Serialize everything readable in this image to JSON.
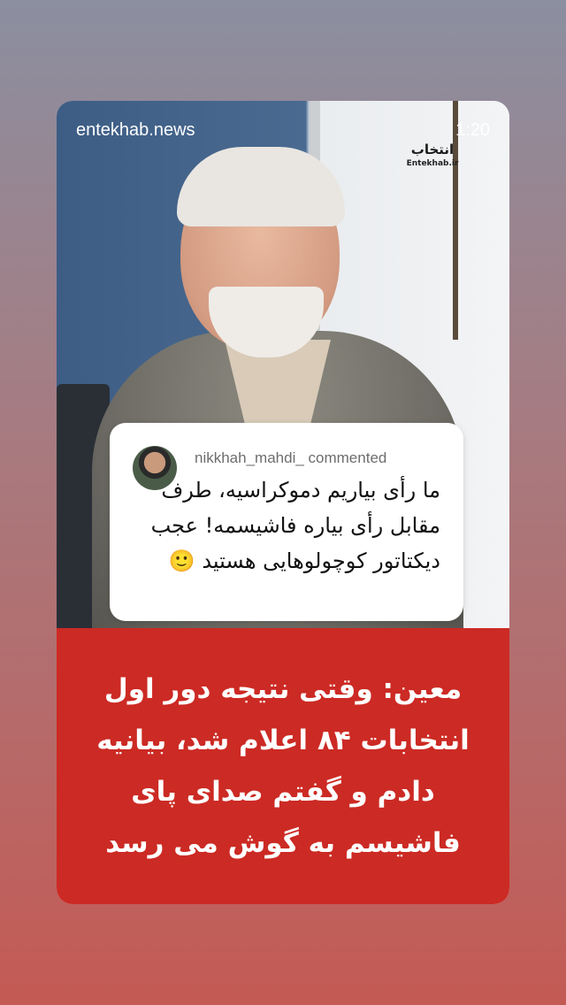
{
  "story": {
    "source": "entekhab.news",
    "duration": "1:20"
  },
  "video": {
    "logo_text": "انتخاب",
    "logo_sub": "Entekhab.ir"
  },
  "comment": {
    "username": "nikkhah_mahdi_ commented",
    "text": "ما رأی بیاریم دموکراسیه، طرف مقابل رأی بیاره فاشیسمه! عجب دیکتاتور کوچولوهایی هستید 🙂"
  },
  "banner": {
    "headline": "معین: وقتی نتیجه دور اول انتخابات ۸۴ اعلام شد، بیانیه دادم و گفتم صدای پای فاشیسم به گوش می رسد"
  },
  "colors": {
    "banner_red": "#cc2a24",
    "logo_accent": "#d2232a"
  }
}
